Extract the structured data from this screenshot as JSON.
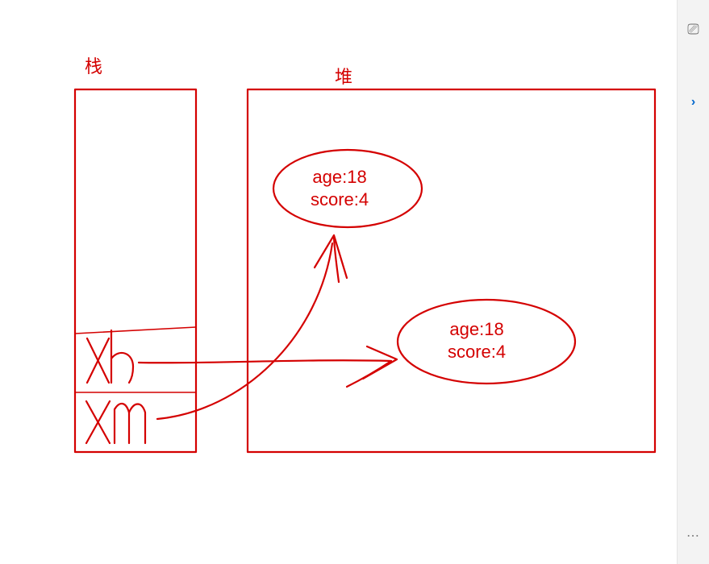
{
  "labels": {
    "stack": "栈",
    "heap": "堆"
  },
  "stack": {
    "vars": [
      "xh",
      "xm"
    ]
  },
  "heap": {
    "objects": [
      {
        "age_key": "age",
        "age_val": "18",
        "score_key": "score",
        "score_val": "4"
      },
      {
        "age_key": "age",
        "age_val": "18",
        "score_key": "score",
        "score_val": "4"
      }
    ]
  },
  "sidebar": {
    "top_icon": "⎚",
    "chevron": "›",
    "dots_icon": "⋯"
  }
}
